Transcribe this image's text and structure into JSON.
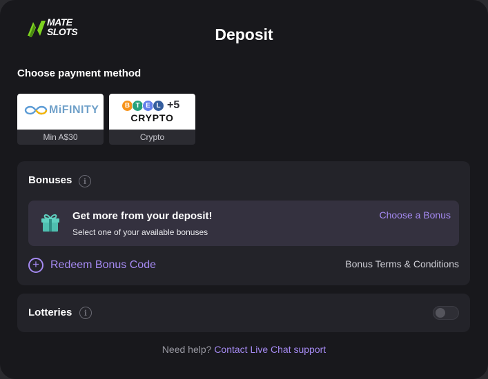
{
  "header": {
    "logo_line1": "MATE",
    "logo_line2": "SLOTS",
    "title": "Deposit"
  },
  "payment": {
    "section_label": "Choose payment method",
    "methods": [
      {
        "name": "MiFINITY",
        "caption": "Min A$30"
      },
      {
        "name": "CRYPTO",
        "extra_count": "+5",
        "coins": [
          "B",
          "T",
          "E",
          "L"
        ],
        "caption": "Crypto"
      }
    ]
  },
  "bonuses": {
    "title": "Bonuses",
    "info_icon": "i",
    "promo_title": "Get more from your deposit!",
    "promo_subtitle": "Select one of your available bonuses",
    "choose_link": "Choose a Bonus",
    "redeem_label": "Redeem Bonus Code",
    "terms_link": "Bonus Terms & Conditions"
  },
  "lotteries": {
    "title": "Lotteries",
    "info_icon": "i",
    "toggle_on": false
  },
  "footer": {
    "help_text": "Need help?",
    "help_link": "Contact Live Chat support"
  },
  "colors": {
    "background": "#18181c",
    "card": "#232329",
    "promo": "#34313f",
    "accent": "#a58af2",
    "logo_green": "#7ed321"
  },
  "icons": [
    "mate-slots-logo-icon",
    "info-icon",
    "gift-icon",
    "plus-circle-icon",
    "toggle-switch"
  ]
}
